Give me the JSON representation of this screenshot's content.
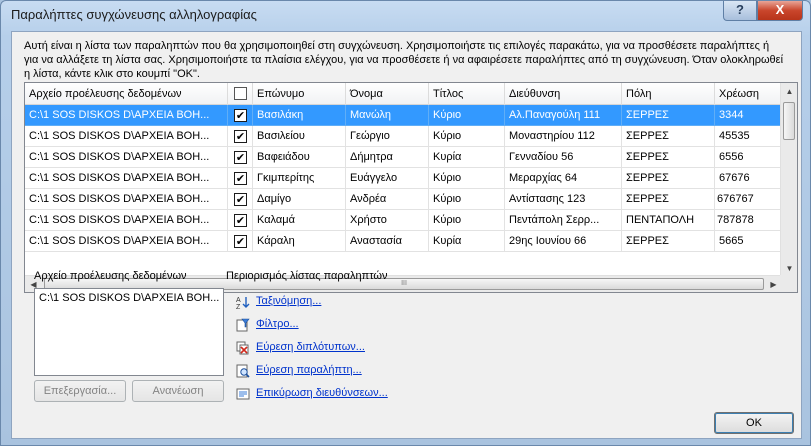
{
  "window": {
    "title": "Παραλήπτες συγχώνευσης αλληλογραφίας",
    "help_label": "?",
    "close_label": "X"
  },
  "description": "Αυτή είναι η λίστα των παραληπτών που θα χρησιμοποιηθεί στη συγχώνευση. Χρησιμοποιήστε τις επιλογές παρακάτω, για να προσθέσετε παραλήπτες ή για να αλλάξετε τη λίστα σας. Χρησιμοποιήστε τα πλαίσια ελέγχου, για να προσθέσετε ή να αφαιρέσετε παραλήπτες από τη συγχώνευση. Όταν ολοκληρωθεί η λίστα, κάντε κλικ στο κουμπί \"ΟΚ\".",
  "table": {
    "columns": [
      "Αρχείο προέλευσης δεδομένων",
      "",
      "Επώνυμο",
      "Όνομα",
      "Τίτλος",
      "Διεύθυνση",
      "Πόλη",
      "Χρέωση"
    ],
    "rows": [
      {
        "source": "C:\\1 SOS DISKOS D\\ΑΡΧΕΙΑ ΒΟΗ...",
        "checked": true,
        "last": "Βασιλάκη",
        "first": "Μανώλη",
        "title": "Κύριο",
        "address": "Αλ.Παναγούλη 111",
        "city": "ΣΕΡΡΕΣ",
        "charge": "3344",
        "selected": true
      },
      {
        "source": "C:\\1 SOS DISKOS D\\ΑΡΧΕΙΑ ΒΟΗ...",
        "checked": true,
        "last": "Βασιλείου",
        "first": "Γεώργιο",
        "title": "Κύριο",
        "address": "Μοναστηρίου 112",
        "city": "ΣΕΡΡΕΣ",
        "charge": "45535",
        "selected": false
      },
      {
        "source": "C:\\1 SOS DISKOS D\\ΑΡΧΕΙΑ ΒΟΗ...",
        "checked": true,
        "last": "Βαφειάδου",
        "first": "Δήμητρα",
        "title": "Κυρία",
        "address": "Γενναδίου 56",
        "city": "ΣΕΡΡΕΣ",
        "charge": "6556",
        "selected": false
      },
      {
        "source": "C:\\1 SOS DISKOS D\\ΑΡΧΕΙΑ ΒΟΗ...",
        "checked": true,
        "last": "Γκιμπερίτης",
        "first": "Ευάγγελο",
        "title": "Κύριο",
        "address": "Μεραρχίας 64",
        "city": "ΣΕΡΡΕΣ",
        "charge": "67676",
        "selected": false
      },
      {
        "source": "C:\\1 SOS DISKOS D\\ΑΡΧΕΙΑ ΒΟΗ...",
        "checked": true,
        "last": "Δαμίγο",
        "first": "Ανδρέα",
        "title": "Κύριο",
        "address": "Αντίστασης 123",
        "city": "ΣΕΡΡΕΣ",
        "charge": "676767",
        "selected": false
      },
      {
        "source": "C:\\1 SOS DISKOS D\\ΑΡΧΕΙΑ ΒΟΗ...",
        "checked": true,
        "last": "Καλαμά",
        "first": "Χρήστο",
        "title": "Κύριο",
        "address": "Πεντάπολη Σερρ...",
        "city": "ΠΕΝΤΑΠΟΛΗ",
        "charge": "787878",
        "selected": false
      },
      {
        "source": "C:\\1 SOS DISKOS D\\ΑΡΧΕΙΑ ΒΟΗ...",
        "checked": true,
        "last": "Κάραλη",
        "first": "Αναστασία",
        "title": "Κυρία",
        "address": "29ης Ιουνίου 66",
        "city": "ΣΕΡΡΕΣ",
        "charge": "5665",
        "selected": false
      }
    ],
    "check_mark": "✔",
    "scroll_grip": "III"
  },
  "sources_panel": {
    "label": "Αρχείο προέλευσης δεδομένων",
    "items": [
      "C:\\1 SOS DISKOS D\\ΑΡΧΕΙΑ ΒΟΗ..."
    ],
    "edit_label": "Επεξεργασία...",
    "refresh_label": "Ανανέωση"
  },
  "refine_panel": {
    "label": "Περιορισμός λίστας παραληπτών",
    "links": [
      {
        "label": "Ταξινόμηση...",
        "icon": "sort-icon"
      },
      {
        "label": "Φίλτρο...",
        "icon": "filter-icon"
      },
      {
        "label": "Εύρεση διπλότυπων...",
        "icon": "find-duplicates-icon"
      },
      {
        "label": "Εύρεση παραλήπτη...",
        "icon": "find-recipient-icon"
      },
      {
        "label": "Επικύρωση διευθύνσεων...",
        "icon": "validate-addresses-icon"
      }
    ]
  },
  "ok_label": "OK",
  "colors": {
    "selection": "#3399ff",
    "link": "#0033cc"
  }
}
